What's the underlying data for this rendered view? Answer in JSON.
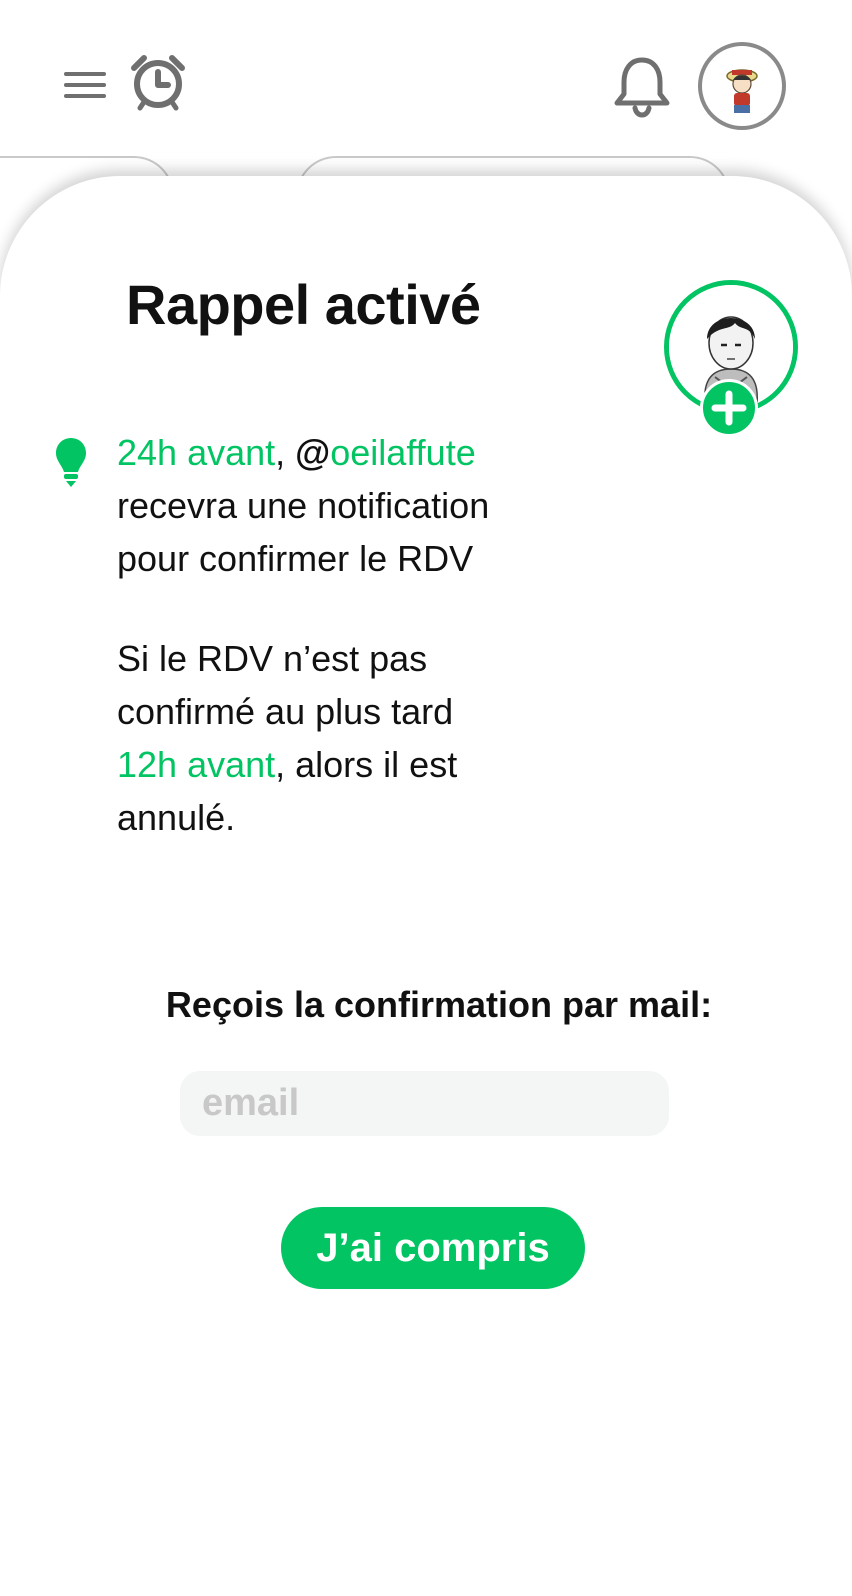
{
  "header": {
    "icons": {
      "menu": "menu-icon",
      "alarm": "alarm-clock-icon",
      "notifications": "bell-icon",
      "profile": "user-avatar"
    }
  },
  "modal": {
    "title": "Rappel activé",
    "reminder": {
      "timing": "24h avant",
      "separator": ", ",
      "at": "@",
      "username": "oeilaffute",
      "line2": "recevra une notification",
      "line3": "pour confirmer le RDV"
    },
    "cancel_rule": {
      "line1": "Si le RDV n’est pas",
      "line2": "confirmé au plus tard",
      "deadline": "12h avant",
      "line3_rest": ", alors il est",
      "line4": "annulé."
    },
    "mail_label": "Reçois la confirmation par mail:",
    "email_placeholder": "email",
    "email_value": "",
    "confirm_button": "J’ai compris"
  },
  "colors": {
    "accent": "#02c463",
    "icon_gray": "#6f6f6f",
    "input_bg": "#f4f5f5"
  }
}
